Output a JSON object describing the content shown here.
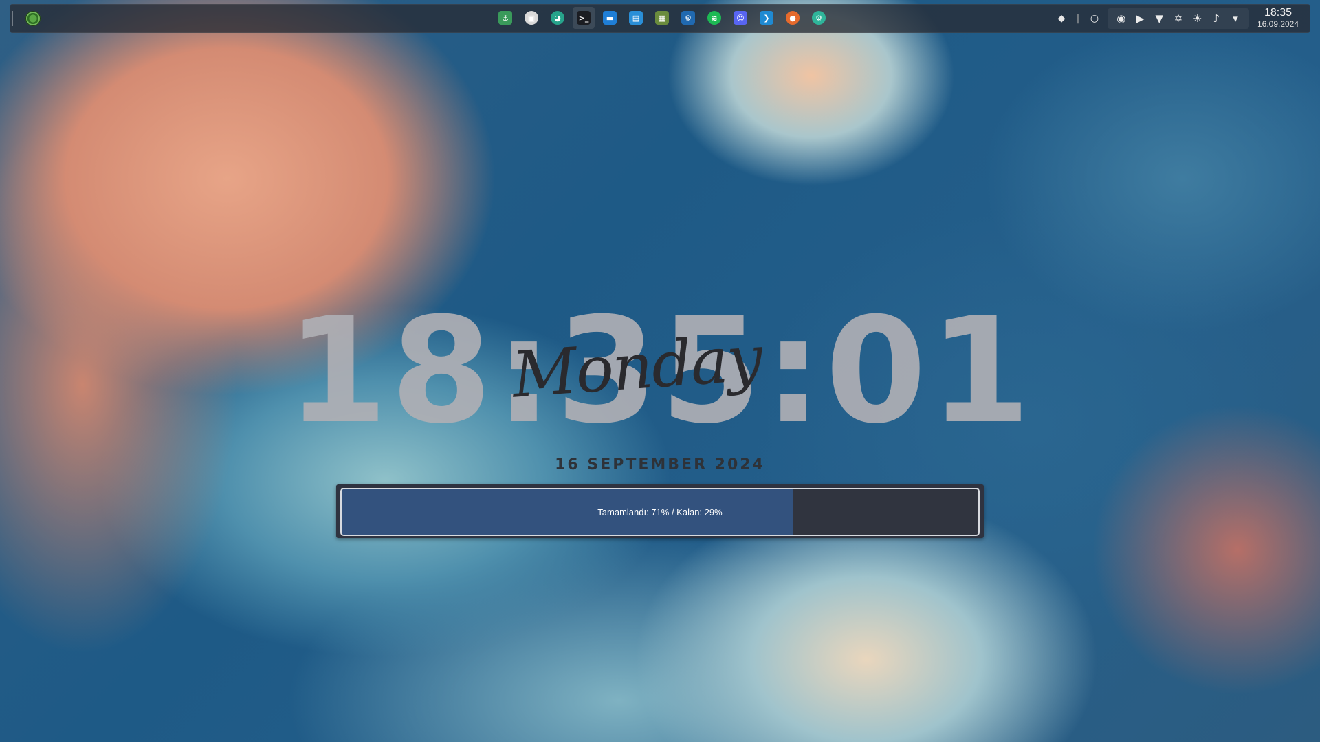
{
  "panel": {
    "launcher_icon": "opensuse-logo-icon",
    "tasks": [
      {
        "name": "taskmanager-app",
        "icon": "plug-icon",
        "color": "#3a9a5b",
        "glyph": "⚓"
      },
      {
        "name": "disk-app",
        "icon": "disk-icon",
        "color": "#d9d9d9",
        "glyph": "▣"
      },
      {
        "name": "elephant-app",
        "icon": "elephant-icon",
        "color": "#27a38b",
        "glyph": "◕"
      },
      {
        "name": "terminal-app",
        "icon": "terminal-icon",
        "color": "#1b1d22",
        "glyph": ">_"
      },
      {
        "name": "window-app",
        "icon": "window-icon",
        "color": "#1f7ed6",
        "glyph": "▬"
      },
      {
        "name": "files-app",
        "icon": "folder-icon",
        "color": "#2a8fd8",
        "glyph": "▤"
      },
      {
        "name": "minecraft-app",
        "icon": "minecraft-icon",
        "color": "#6a8c3d",
        "glyph": "▦"
      },
      {
        "name": "steam-app",
        "icon": "steam-icon",
        "color": "#2069b0",
        "glyph": "⚙"
      },
      {
        "name": "spotify-app",
        "icon": "spotify-icon",
        "color": "#1db954",
        "glyph": "≋"
      },
      {
        "name": "discord-app",
        "icon": "discord-icon",
        "color": "#5865f2",
        "glyph": "☺"
      },
      {
        "name": "vscode-app",
        "icon": "vscode-icon",
        "color": "#1f8ad2",
        "glyph": "❯"
      },
      {
        "name": "firefox-app",
        "icon": "firefox-icon",
        "color": "#e66a2c",
        "glyph": "●"
      },
      {
        "name": "settings-app",
        "icon": "gear-icon",
        "color": "#2fb59a",
        "glyph": "⚙"
      }
    ],
    "tray": {
      "drop_glyph": "◆",
      "sep_glyph": "|",
      "circle_glyph": "○",
      "icons2": [
        {
          "name": "steam-tray-icon",
          "glyph": "◉"
        },
        {
          "name": "media-play-icon",
          "glyph": "▶"
        },
        {
          "name": "wifi-icon",
          "glyph": "▼"
        },
        {
          "name": "bluetooth-icon",
          "glyph": "✡"
        },
        {
          "name": "brightness-icon",
          "glyph": "☀"
        },
        {
          "name": "volume-icon",
          "glyph": "♪"
        },
        {
          "name": "expand-tray-icon",
          "glyph": "▾"
        }
      ]
    },
    "clock": {
      "time": "18:35",
      "date": "16.09.2024"
    }
  },
  "desktop": {
    "big_time": "18:35:01",
    "weekday": "Monday",
    "date": "16 SEPTEMBER 2024",
    "progress": {
      "percent": 71,
      "label": "Tamamlandı: 71% / Kalan: 29%",
      "fill_color": "#33527e"
    }
  }
}
